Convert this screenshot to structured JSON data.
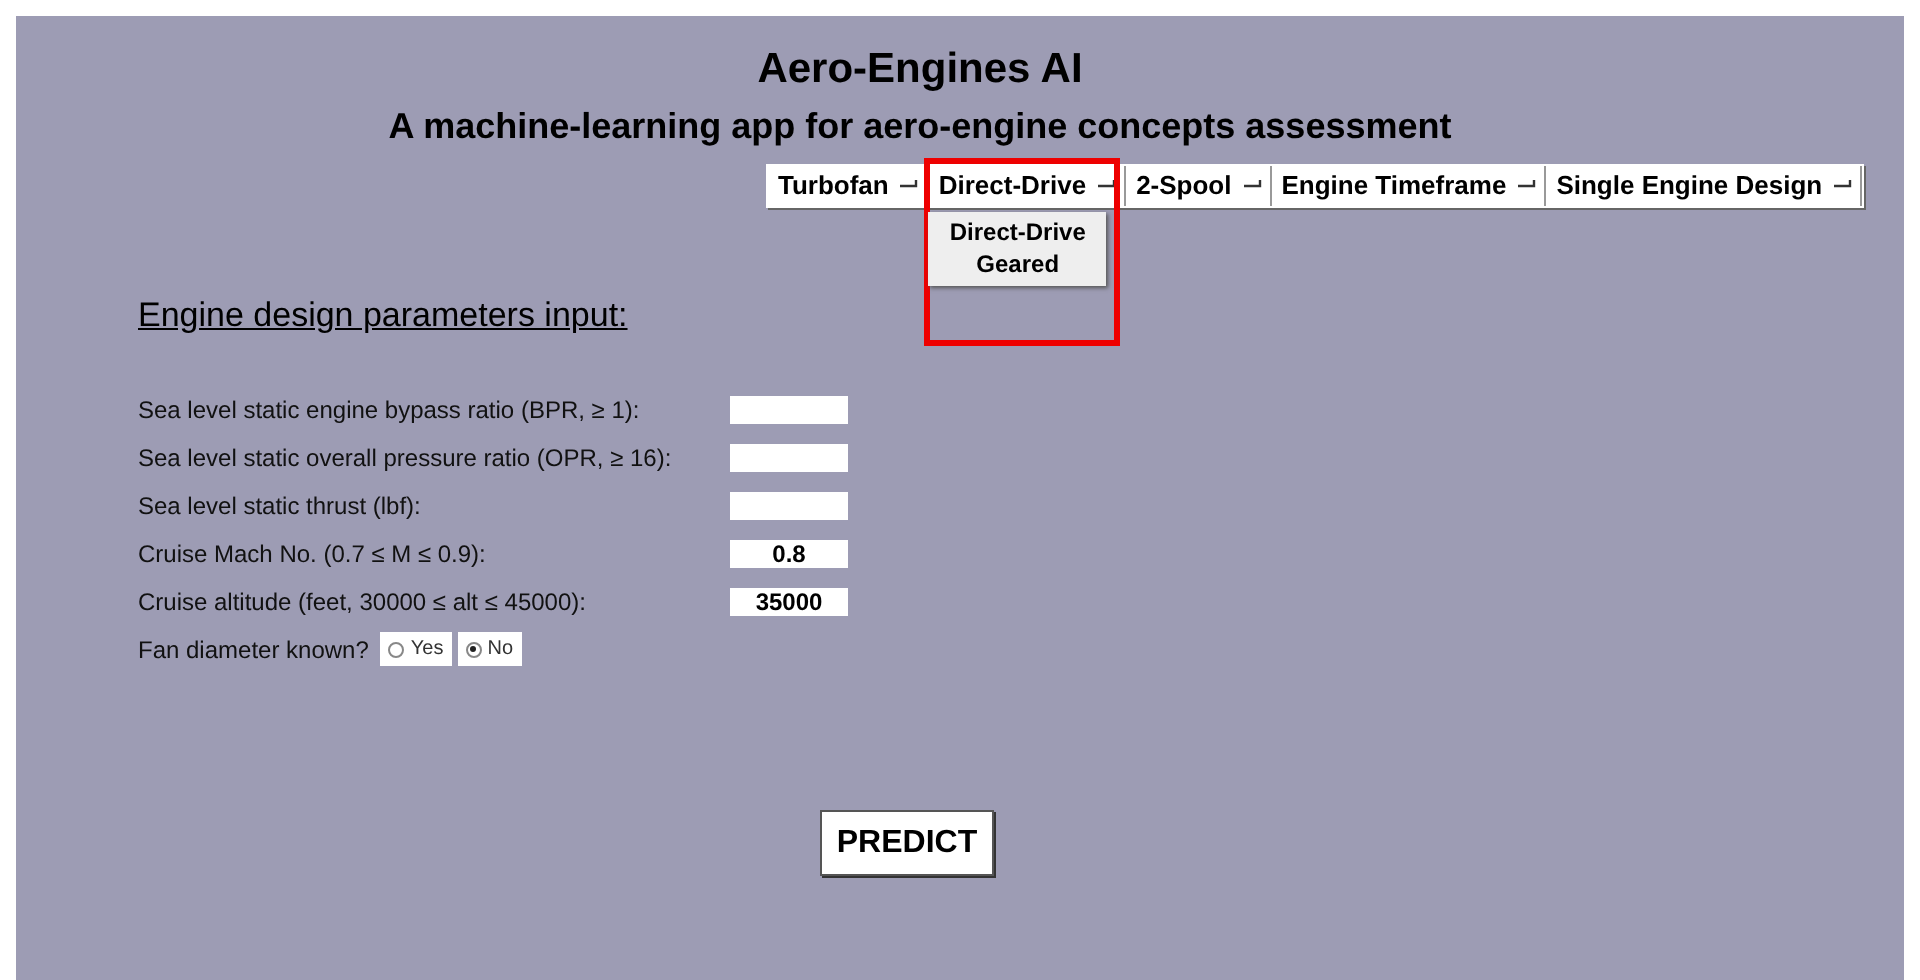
{
  "title": "Aero-Engines AI",
  "subtitle": "A machine-learning app for aero-engine concepts assessment",
  "menus": [
    {
      "label": "Turbofan"
    },
    {
      "label": "Direct-Drive",
      "options": [
        "Direct-Drive",
        "Geared"
      ]
    },
    {
      "label": "2-Spool"
    },
    {
      "label": "Engine Timeframe"
    },
    {
      "label": "Single Engine Design"
    }
  ],
  "section_heading": "Engine design parameters input:",
  "fields": [
    {
      "label": "Sea level static engine bypass ratio (BPR, ≥ 1):"
    },
    {
      "label": "Sea level static overall pressure ratio (OPR, ≥ 16):"
    },
    {
      "label": "Sea level static thrust (lbf):"
    },
    {
      "label": "Cruise Mach No. (0.7 ≤ M ≤ 0.9):",
      "value": "0.8"
    },
    {
      "label": "Cruise altitude (feet, 30000 ≤ alt ≤ 45000):",
      "value": "35000"
    }
  ],
  "fan_diameter": {
    "label": "Fan diameter known?",
    "options": [
      {
        "label": "Yes",
        "selected": false
      },
      {
        "label": "No",
        "selected": true
      }
    ]
  },
  "predict_button": "PREDICT"
}
